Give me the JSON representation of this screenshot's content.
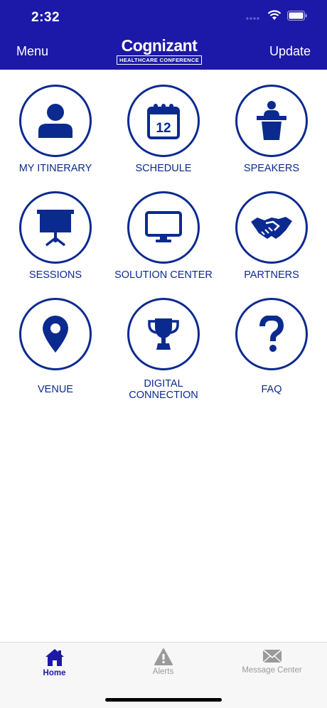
{
  "status_bar": {
    "time": "2:32"
  },
  "header": {
    "menu_label": "Menu",
    "update_label": "Update",
    "logo_word": "Cognizant",
    "logo_subtitle": "HEALTHCARE CONFERENCE"
  },
  "tiles": [
    {
      "label": "MY ITINERARY",
      "icon": "user-icon"
    },
    {
      "label": "SCHEDULE",
      "icon": "calendar-icon",
      "calendar_day": "12"
    },
    {
      "label": "SPEAKERS",
      "icon": "podium-icon"
    },
    {
      "label": "SESSIONS",
      "icon": "presentation-board-icon"
    },
    {
      "label": "SOLUTION CENTER",
      "icon": "monitor-icon"
    },
    {
      "label": "PARTNERS",
      "icon": "handshake-icon"
    },
    {
      "label": "VENUE",
      "icon": "map-pin-icon"
    },
    {
      "label": "DIGITAL CONNECTION",
      "line1": "DIGITAL",
      "line2": "CONNECTION",
      "icon": "trophy-icon"
    },
    {
      "label": "FAQ",
      "icon": "question-mark-icon"
    }
  ],
  "tabbar": {
    "items": [
      {
        "label": "Home",
        "icon": "home-icon",
        "active": true
      },
      {
        "label": "Alerts",
        "icon": "warning-icon",
        "active": false
      },
      {
        "label": "Message Center",
        "icon": "envelope-icon",
        "active": false
      }
    ]
  },
  "colors": {
    "header_bg": "#1c19a8",
    "icon_blue": "#0b2a8f",
    "tab_active": "#1c19a8",
    "tab_inactive": "#9a9a9a"
  }
}
